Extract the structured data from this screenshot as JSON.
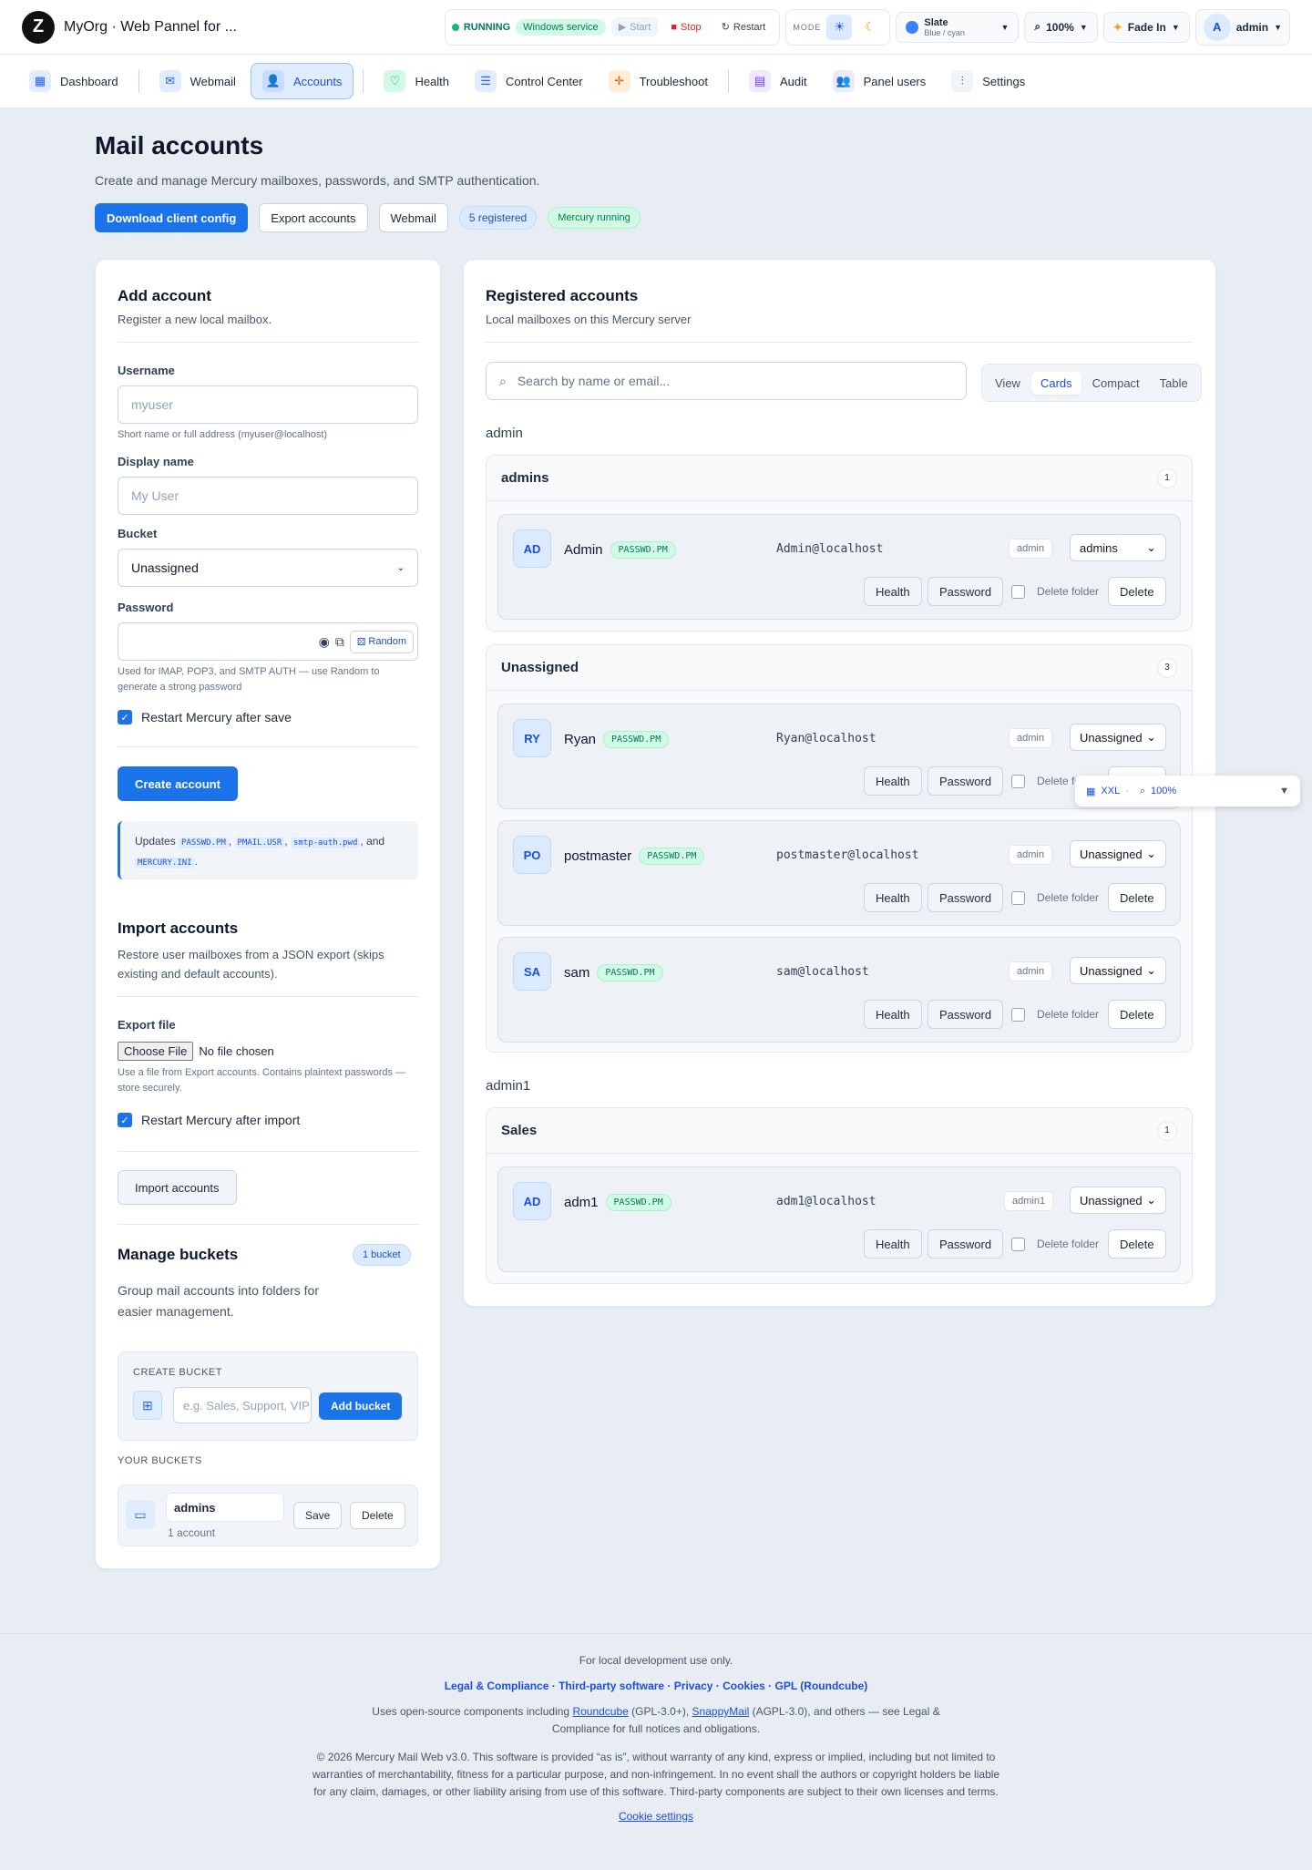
{
  "app": {
    "title": "MyOrg · Web Pannel for ...",
    "logo_letter": "Z"
  },
  "service": {
    "status": "RUNNING",
    "type": "Windows service",
    "start": "Start",
    "stop": "Stop",
    "restart": "Restart"
  },
  "mode": {
    "label": "MODE",
    "light_icon": "sun-icon",
    "dark_icon": "moon-icon"
  },
  "theme": {
    "name": "Slate",
    "variant": "Blue / cyan"
  },
  "zoom": "100%",
  "animation": "Fade In",
  "user": {
    "initial": "A",
    "name": "admin"
  },
  "nav": [
    {
      "label": "Dashboard",
      "icon": "dashboard-icon"
    },
    {
      "label": "Webmail",
      "icon": "mail-icon"
    },
    {
      "label": "Accounts",
      "icon": "users-icon",
      "active": true
    },
    {
      "label": "Health",
      "icon": "heart-icon"
    },
    {
      "label": "Control Center",
      "icon": "server-icon"
    },
    {
      "label": "Troubleshoot",
      "icon": "bug-icon"
    },
    {
      "label": "Audit",
      "icon": "clipboard-icon"
    },
    {
      "label": "Panel users",
      "icon": "user-group-icon"
    },
    {
      "label": "Settings",
      "icon": "sliders-icon"
    }
  ],
  "page": {
    "title": "Mail accounts",
    "subtitle": "Create and manage Mercury mailboxes, passwords, and SMTP authentication.",
    "download_btn": "Download client config",
    "export_btn": "Export accounts",
    "webmail_btn": "Webmail",
    "registered_badge": "5 registered",
    "mercury_badge": "Mercury running"
  },
  "add": {
    "title": "Add account",
    "subtitle": "Register a new local mailbox.",
    "username_label": "Username",
    "username_placeholder": "myuser",
    "username_help": "Short name or full address (myuser@localhost)",
    "display_label": "Display name",
    "display_placeholder": "My User",
    "bucket_label": "Bucket",
    "bucket_value": "Unassigned",
    "password_label": "Password",
    "random_btn": "Random",
    "password_help": "Used for IMAP, POP3, and SMTP AUTH — use Random to generate a strong password",
    "restart_label": "Restart Mercury after save",
    "create_btn": "Create account",
    "note_prefix": "Updates",
    "files": [
      "PASSWD.PM",
      "PMAIL.USR",
      "smtp-auth.pwd",
      "MERCURY.INI"
    ],
    "note_and": "and"
  },
  "import": {
    "title": "Import accounts",
    "subtitle": "Restore user mailboxes from a JSON export (skips existing and default accounts).",
    "file_label": "Export file",
    "choose_btn": "Choose File",
    "no_file": "No file chosen",
    "help": "Use a file from Export accounts. Contains plaintext passwords — store securely.",
    "restart_label": "Restart Mercury after import",
    "import_btn": "Import accounts"
  },
  "buckets": {
    "title": "Manage buckets",
    "count_badge": "1 bucket",
    "subtitle": "Group mail accounts into folders for easier management.",
    "create_label": "CREATE BUCKET",
    "create_placeholder": "e.g. Sales, Support, VIP",
    "add_btn": "Add bucket",
    "yours_label": "YOUR BUCKETS",
    "items": [
      {
        "name": "admins",
        "count": "1 account",
        "save": "Save",
        "delete": "Delete"
      }
    ]
  },
  "registered": {
    "title": "Registered accounts",
    "subtitle": "Local mailboxes on this Mercury server",
    "search_placeholder": "Search by name or email...",
    "view_label": "View",
    "views": [
      "Cards",
      "Compact",
      "Table"
    ],
    "owners": [
      {
        "name": "admin",
        "groups": [
          {
            "name": "admins",
            "count": "1",
            "accounts": [
              {
                "initials": "AD",
                "name": "Admin",
                "tag": "PASSWD.PM",
                "email": "Admin@localhost",
                "owner": "admin",
                "bucket": "admins"
              }
            ]
          },
          {
            "name": "Unassigned",
            "count": "3",
            "accounts": [
              {
                "initials": "RY",
                "name": "Ryan",
                "tag": "PASSWD.PM",
                "email": "Ryan@localhost",
                "owner": "admin",
                "bucket": "Unassigned"
              },
              {
                "initials": "PO",
                "name": "postmaster",
                "tag": "PASSWD.PM",
                "email": "postmaster@localhost",
                "owner": "admin",
                "bucket": "Unassigned"
              },
              {
                "initials": "SA",
                "name": "sam",
                "tag": "PASSWD.PM",
                "email": "sam@localhost",
                "owner": "admin",
                "bucket": "Unassigned"
              }
            ]
          }
        ]
      },
      {
        "name": "admin1",
        "groups": [
          {
            "name": "Sales",
            "count": "1",
            "accounts": [
              {
                "initials": "AD",
                "name": "adm1",
                "tag": "PASSWD.PM",
                "email": "adm1@localhost",
                "owner": "admin1",
                "bucket": "Unassigned"
              }
            ]
          }
        ]
      }
    ],
    "health_btn": "Health",
    "password_btn": "Password",
    "delete_folder_label": "Delete folder",
    "delete_btn": "Delete"
  },
  "floating": {
    "size": "XXL",
    "zoom": "100%"
  },
  "footer": {
    "line1": "For local development use only.",
    "links": [
      "Legal & Compliance",
      "Third-party software",
      "Privacy",
      "Cookies",
      "GPL (Roundcube)"
    ],
    "oss_prefix": "Uses open-source components including",
    "roundcube": "Roundcube",
    "roundcube_lic": "(GPL-3.0+),",
    "snappymail": "SnappyMail",
    "oss_suffix": "(AGPL-3.0), and others — see Legal & Compliance for full notices and obligations.",
    "copyright": "© 2026 Mercury Mail Web v3.0. This software is provided “as is”, without warranty of any kind, express or implied, including but not limited to warranties of merchantability, fitness for a particular purpose, and non-infringement. In no event shall the authors or copyright holders be liable for any claim, damages, or other liability arising from use of this software. Third-party components are subject to their own licenses and terms.",
    "cookie_settings": "Cookie settings"
  }
}
